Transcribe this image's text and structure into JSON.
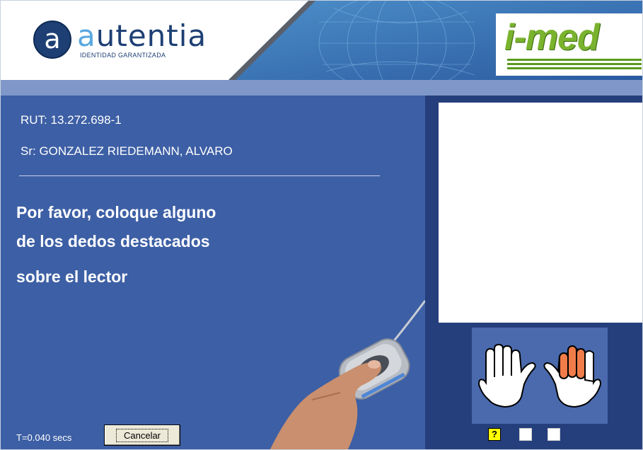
{
  "header": {
    "logo_letter": "a",
    "logo_name_first": "a",
    "logo_name_rest": "utentia",
    "logo_tagline": "IDENTIDAD GARANTIZADA",
    "partner_logo": "i-med"
  },
  "patient": {
    "rut": "RUT:  13.272.698-1",
    "name": "Sr:  GONZALEZ RIEDEMANN, ALVARO"
  },
  "instructions": [
    "Por favor, coloque alguno",
    "de los dedos destacados",
    "sobre el lector"
  ],
  "footer": {
    "timer": "T=0.040 secs",
    "cancel_label": "Cancelar"
  },
  "finger_status": [
    "?",
    "",
    ""
  ],
  "colors": {
    "main_bg": "#3d5fa5",
    "right_bg": "#253f7d",
    "highlight_finger": "#f07c4a",
    "status_pending": "#ffff00",
    "imed_green": "#7ab32e"
  },
  "highlighted_fingers": {
    "left_hand": [],
    "right_hand": [
      "index",
      "middle",
      "ring"
    ]
  },
  "icons": [
    "fingerprint-reader-icon",
    "left-hand-icon",
    "right-hand-icon"
  ]
}
